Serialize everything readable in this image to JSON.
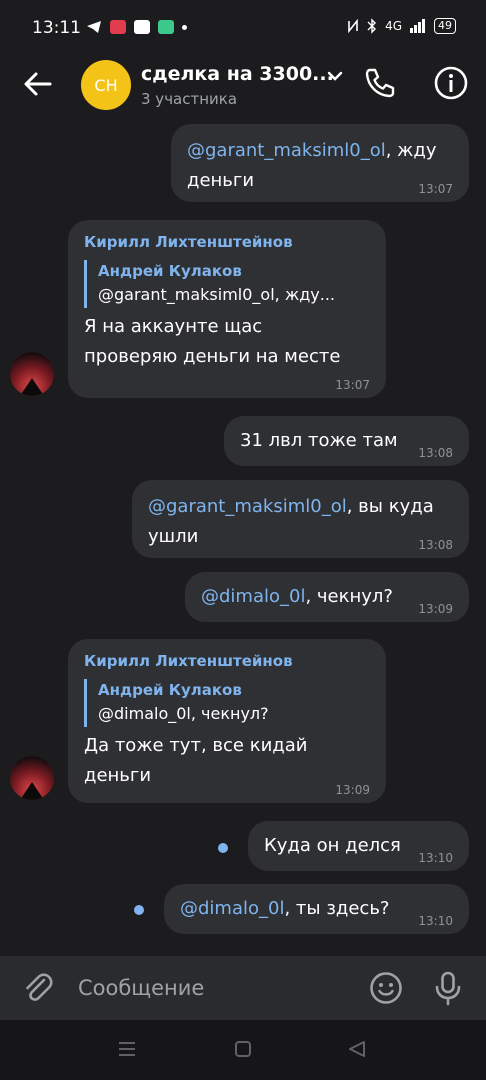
{
  "status": {
    "time": "13:11",
    "battery": "49",
    "network": "4G"
  },
  "header": {
    "avatar_initials": "СН",
    "title": "сделка на 3300...",
    "subtitle": "3 участника"
  },
  "messages": {
    "m1": {
      "mention": "@garant_maksiml0_ol",
      "line1_rest": ",  жду",
      "line2": "деньги",
      "time": "13:07"
    },
    "m2": {
      "sender": "Кирилл Лихтенштейнов",
      "quote_name": "Андрей Кулаков",
      "quote_text": "@garant_maksiml0_ol,  жду...",
      "line1": "Я на аккаунте щас",
      "line2": "проверяю деньги на месте",
      "time": "13:07"
    },
    "m3": {
      "text": "31 лвл тоже там",
      "time": "13:08"
    },
    "m4": {
      "mention": "@garant_maksiml0_ol",
      "line1_rest": ",  вы куда",
      "line2": "ушли",
      "time": "13:08"
    },
    "m5": {
      "mention": "@dimalo_0l",
      "rest": ",  чекнул?",
      "time": "13:09"
    },
    "m6": {
      "sender": "Кирилл Лихтенштейнов",
      "quote_name": "Андрей Кулаков",
      "quote_text": "@dimalo_0l,  чекнул?",
      "line1": "Да тоже тут, все кидай",
      "line2": "деньги",
      "time": "13:09"
    },
    "m7": {
      "text": "Куда он делся",
      "time": "13:10"
    },
    "m8": {
      "mention": "@dimalo_0l",
      "rest": ",  ты здесь?",
      "time": "13:10"
    }
  },
  "input": {
    "placeholder": "Сообщение"
  },
  "colors": {
    "background": "#1c1c1e",
    "bubble": "#2f3033",
    "accent": "#7fb4ef",
    "group_avatar": "#f4c318"
  },
  "icons": [
    "back-arrow-icon",
    "chevron-down-icon",
    "phone-icon",
    "info-icon",
    "attach-icon",
    "emoji-icon",
    "mic-icon"
  ]
}
